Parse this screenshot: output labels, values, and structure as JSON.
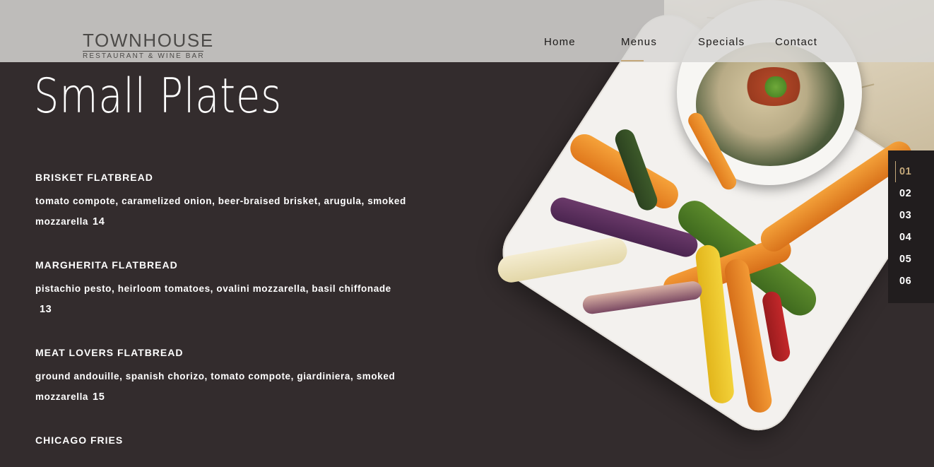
{
  "header": {
    "logo_main": "TOWNHOUSE",
    "logo_sub": "RESTAURANT & WINE BAR",
    "nav": [
      {
        "label": "Home",
        "active": false
      },
      {
        "label": "Menus",
        "active": true
      },
      {
        "label": "Specials",
        "active": false
      },
      {
        "label": "Contact",
        "active": false
      }
    ]
  },
  "section": {
    "title": "Small Plates",
    "items": [
      {
        "name": "BRISKET FLATBREAD",
        "desc": "tomato compote, caramelized onion, beer-braised brisket, arugula, smoked mozzarella",
        "price": "14"
      },
      {
        "name": "MARGHERITA FLATBREAD",
        "desc": "pistachio pesto, heirloom tomatoes, ovalini mozzarella, basil chiffonade",
        "price": "13"
      },
      {
        "name": "MEAT LOVERS FLATBREAD",
        "desc": "ground andouille, spanish chorizo, tomato compote, giardiniera, smoked mozzarella",
        "price": "15"
      },
      {
        "name": "CHICAGO FRIES",
        "desc": "",
        "price": ""
      }
    ]
  },
  "pager": {
    "pages": [
      "01",
      "02",
      "03",
      "04",
      "05",
      "06"
    ],
    "active": "01"
  },
  "colors": {
    "background": "#332c2d",
    "accent": "#c4a87a",
    "header_bg": "#d7d6d4",
    "pager_bg": "#211d1e"
  }
}
